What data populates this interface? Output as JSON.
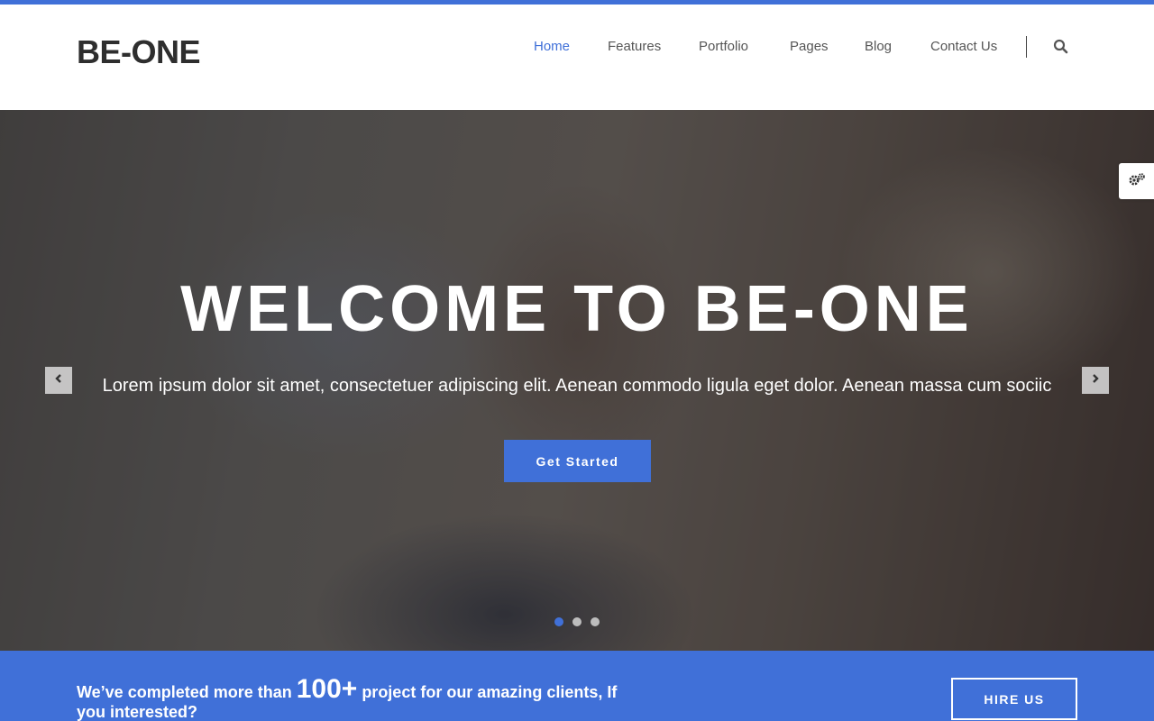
{
  "brand": {
    "name": "BE-ONE",
    "accent_color": "#4070d8"
  },
  "nav": {
    "items": [
      {
        "label": "Home",
        "active": true
      },
      {
        "label": "Features",
        "active": false
      },
      {
        "label": "Portfolio",
        "active": false
      },
      {
        "label": "Pages",
        "active": false
      },
      {
        "label": "Blog",
        "active": false
      },
      {
        "label": "Contact Us",
        "active": false
      }
    ],
    "search_icon": "search-icon"
  },
  "hero": {
    "title": "WELCOME TO BE-ONE",
    "subtitle": "Lorem ipsum dolor sit amet, consectetuer adipiscing elit. Aenean commodo ligula eget dolor. Aenean massa cum sociic",
    "cta_label": "Get Started",
    "prev_icon": "chevron-left-icon",
    "next_icon": "chevron-right-icon",
    "slide_count": 3,
    "active_slide": 1
  },
  "settings": {
    "icon": "gears-icon"
  },
  "cta_band": {
    "text_before": "We’ve completed more than ",
    "highlight": "100+",
    "text_after": " project for our amazing clients, If you interested?",
    "button_label": "HIRE US"
  }
}
